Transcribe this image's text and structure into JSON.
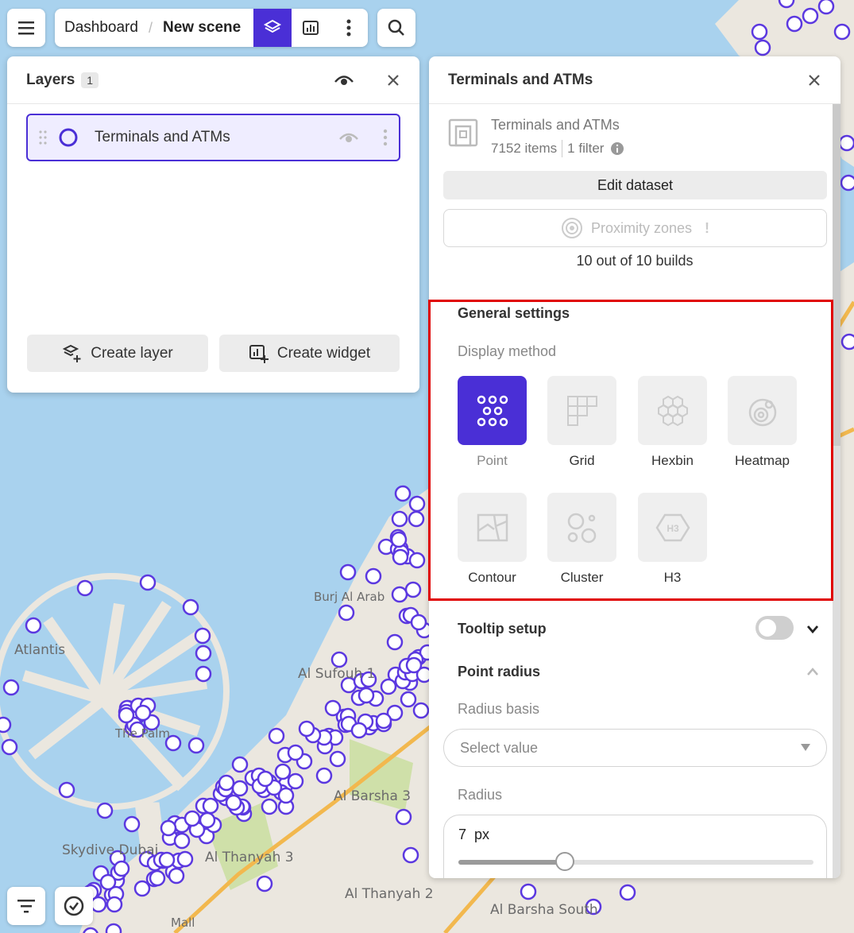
{
  "colors": {
    "accent": "#4a2fd6",
    "water": "#a9d2ee",
    "land": "#ebe7df",
    "park": "#cfe0a9",
    "road": "#f2b84e",
    "highlight": "#e00000"
  },
  "topbar": {
    "menu_icon": "hamburger-icon",
    "breadcrumb_root": "Dashboard",
    "breadcrumb_separator": "/",
    "breadcrumb_current": "New scene",
    "layers_icon": "layers-icon",
    "widgets_icon": "chart-icon",
    "more_icon": "more-vertical-icon",
    "search_icon": "search-icon"
  },
  "layers_panel": {
    "title": "Layers",
    "count": "1",
    "layers": [
      {
        "name": "Terminals and ATMs"
      }
    ],
    "create_layer_label": "Create layer",
    "create_widget_label": "Create widget"
  },
  "settings_panel": {
    "title": "Terminals and ATMs",
    "dataset_name": "Terminals and ATMs",
    "items_count": "7152 items",
    "filter_count": "1 filter",
    "edit_dataset_label": "Edit dataset",
    "proximity_label": "Proximity zones",
    "proximity_warning": "!",
    "builds_text": "10 out of 10 builds",
    "general_settings_title": "General settings",
    "display_method_label": "Display method",
    "display_methods": [
      {
        "label": "Point",
        "icon": "point-icon",
        "selected": true
      },
      {
        "label": "Grid",
        "icon": "grid-icon",
        "selected": false
      },
      {
        "label": "Hexbin",
        "icon": "hexbin-icon",
        "selected": false
      },
      {
        "label": "Heatmap",
        "icon": "heatmap-icon",
        "selected": false
      },
      {
        "label": "Contour",
        "icon": "contour-icon",
        "selected": false
      },
      {
        "label": "Cluster",
        "icon": "cluster-icon",
        "selected": false
      },
      {
        "label": "H3",
        "icon": "h3-icon",
        "selected": false
      }
    ],
    "tooltip_setup_label": "Tooltip setup",
    "tooltip_enabled": false,
    "point_radius_title": "Point radius",
    "radius_basis_label": "Radius basis",
    "radius_basis_placeholder": "Select value",
    "radius_label": "Radius",
    "radius_value": "7",
    "radius_unit": "px",
    "radius_slider_fraction": 0.3
  },
  "map": {
    "labels": [
      "Atlantis",
      "Skydive Dubai",
      "Burj Al Arab",
      "Al Sufouh 1",
      "Al Barsha 3",
      "Al Thanyah 3",
      "Al Thanyah 2",
      "Al Barsha South",
      "The Palm",
      "Mall"
    ]
  }
}
